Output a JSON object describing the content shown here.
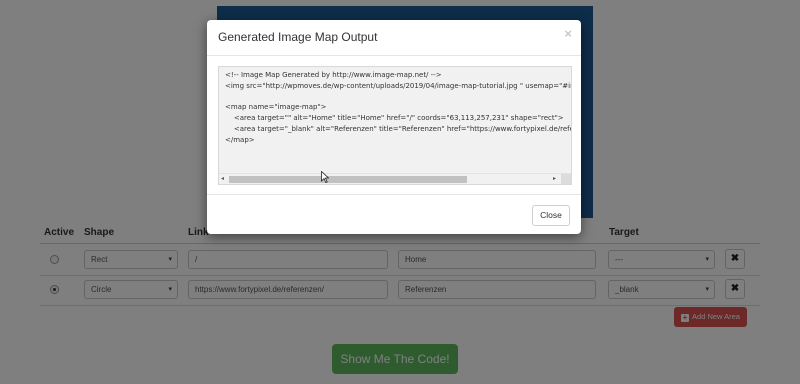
{
  "table": {
    "headers": {
      "active": "Active",
      "shape": "Shape",
      "link": "Link",
      "target": "Target"
    },
    "rows": [
      {
        "active": false,
        "shape": "Rect",
        "link": "/",
        "title": "Home",
        "target": "---"
      },
      {
        "active": true,
        "shape": "Circle",
        "link": "https://www.fortypixel.de/referenzen/",
        "title": "Referenzen",
        "target": "_blank"
      }
    ]
  },
  "buttons": {
    "add_area": "Add New Area",
    "show_code": "Show Me The Code!",
    "delete_glyph": "✖"
  },
  "modal": {
    "title": "Generated Image Map Output",
    "close_x": "×",
    "close_button": "Close",
    "code": "<!-- Image Map Generated by http://www.image-map.net/ -->\n<img src=\"http://wpmoves.de/wp-content/uploads/2019/04/image-map-tutorial.jpg \" usemap=\"#image-map\">\n\n<map name=\"image-map\">\n    <area target=\"\" alt=\"Home\" title=\"Home\" href=\"/\" coords=\"63,113,257,231\" shape=\"rect\">\n    <area target=\"_blank\" alt=\"Referenzen\" title=\"Referenzen\" href=\"https://www.fortypixel.de/referenzen/\" coords=\"\" shape=\"circle\">\n</map>"
  },
  "colors": {
    "image_blue": "#1d5b94",
    "add_button_red": "#d9534f",
    "show_code_green": "#5cb85c"
  },
  "icons": {
    "select_arrow": "▾",
    "scroll_left": "◂",
    "scroll_right": "▸"
  }
}
